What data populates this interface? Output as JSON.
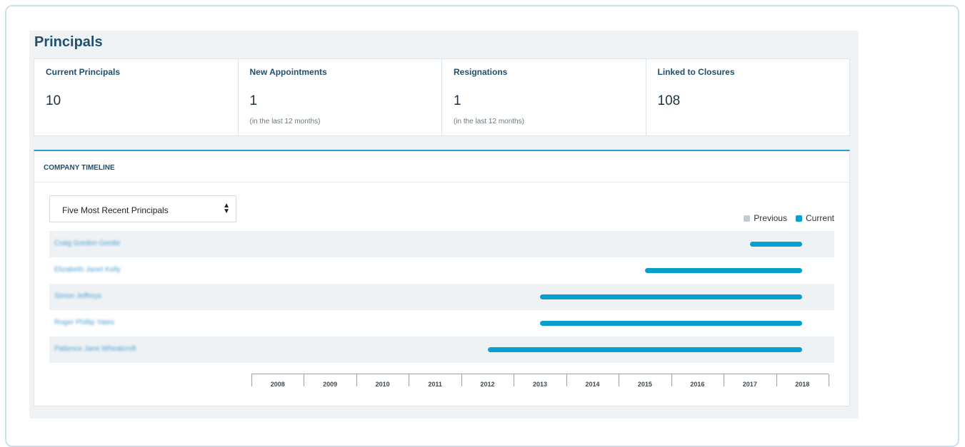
{
  "section_title": "Principals",
  "stats": [
    {
      "label": "Current Principals",
      "value": "10",
      "note": ""
    },
    {
      "label": "New Appointments",
      "value": "1",
      "note": "(in the last 12 months)"
    },
    {
      "label": "Resignations",
      "value": "1",
      "note": "(in the last 12 months)"
    },
    {
      "label": "Linked to Closures",
      "value": "108",
      "note": ""
    }
  ],
  "timeline": {
    "title": "COMPANY TIMELINE",
    "select": {
      "selected": "Five Most Recent Principals",
      "icon": "sort-arrows-icon"
    },
    "legend": [
      {
        "label": "Previous",
        "color": "#c3cbd3"
      },
      {
        "label": "Current",
        "color": "#069fce"
      }
    ]
  },
  "chart_data": {
    "type": "timeline",
    "x": [
      2008,
      2009,
      2010,
      2011,
      2012,
      2013,
      2014,
      2015,
      2016,
      2017,
      2018
    ],
    "xlim": [
      2007.5,
      2018.5
    ],
    "series": [
      {
        "name": "Craig Gordon Gentle",
        "start": 2017.0,
        "end": 2018.0,
        "status": "Current"
      },
      {
        "name": "Elizabeth Janet Kelly",
        "start": 2015.0,
        "end": 2018.0,
        "status": "Current"
      },
      {
        "name": "Simon Jeffreys",
        "start": 2013.0,
        "end": 2018.0,
        "status": "Current"
      },
      {
        "name": "Roger Phillip Yates",
        "start": 2013.0,
        "end": 2018.0,
        "status": "Current"
      },
      {
        "name": "Patience Jane Wheatcroft",
        "start": 2012.0,
        "end": 2018.0,
        "status": "Current"
      }
    ]
  }
}
